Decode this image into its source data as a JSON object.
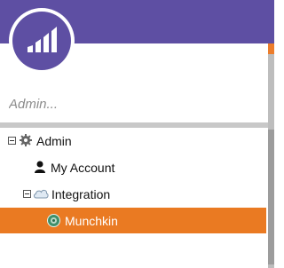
{
  "app": {
    "logo_icon": "marketo-bars-icon",
    "brand_color": "#5e4fa3",
    "accent_color": "#ea7a22"
  },
  "search": {
    "placeholder": "Admin...",
    "value": ""
  },
  "tree": {
    "items": [
      {
        "label": "Admin",
        "icon": "gear-icon",
        "expanded": true
      },
      {
        "label": "My Account",
        "icon": "person-icon"
      },
      {
        "label": "Integration",
        "icon": "cloud-icon",
        "expanded": true
      },
      {
        "label": "Munchkin",
        "icon": "munchkin-icon",
        "selected": true
      }
    ]
  }
}
